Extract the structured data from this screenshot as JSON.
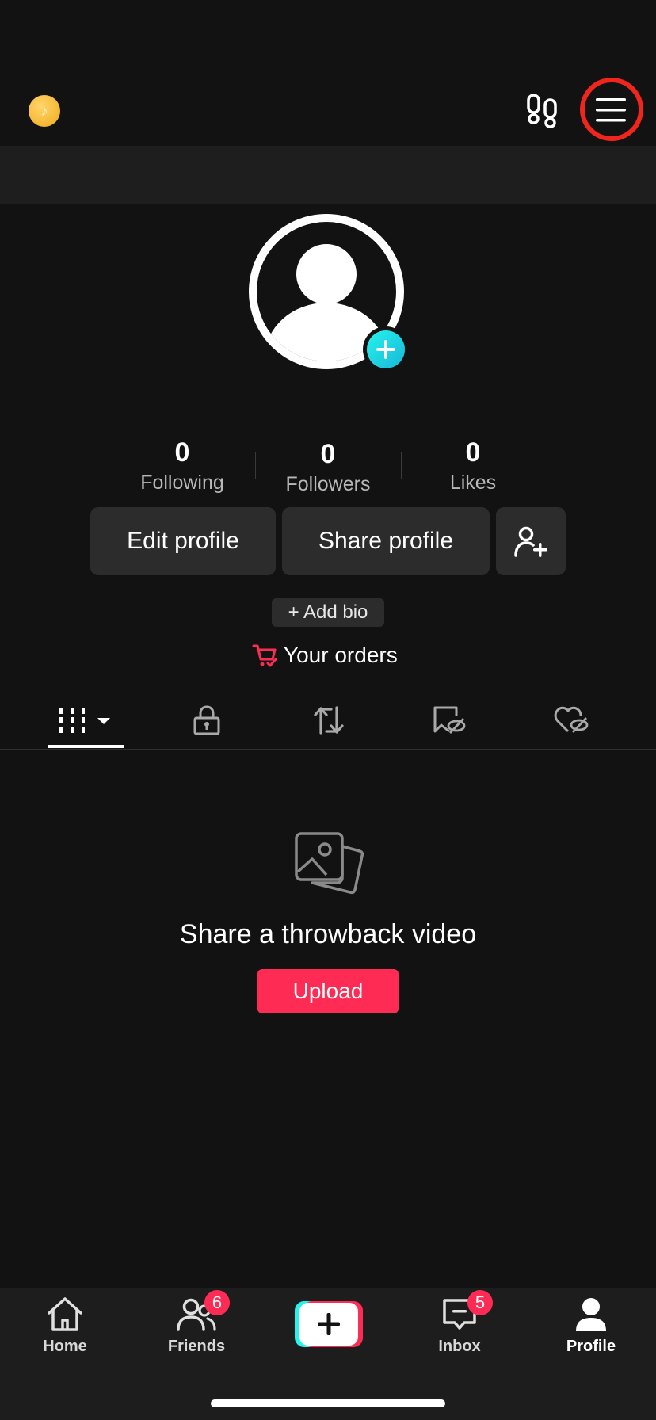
{
  "stats": {
    "following": {
      "count": "0",
      "label": "Following"
    },
    "followers": {
      "count": "0",
      "label": "Followers"
    },
    "likes": {
      "count": "0",
      "label": "Likes"
    }
  },
  "actions": {
    "edit_profile": "Edit profile",
    "share_profile": "Share profile",
    "add_bio": "+ Add bio",
    "your_orders": "Your orders"
  },
  "tabs": [
    {
      "icon": "grid-icon",
      "selected": true
    },
    {
      "icon": "lock-icon",
      "selected": false
    },
    {
      "icon": "repost-icon",
      "selected": false
    },
    {
      "icon": "hidden-bookmark-icon",
      "selected": false
    },
    {
      "icon": "hidden-heart-icon",
      "selected": false
    }
  ],
  "empty_state": {
    "title": "Share a throwback video",
    "button": "Upload"
  },
  "nav": {
    "home": "Home",
    "friends": "Friends",
    "friends_badge": "6",
    "inbox": "Inbox",
    "inbox_badge": "5",
    "profile": "Profile"
  },
  "colors": {
    "background": "#121212",
    "accent": "#fe2c55",
    "teal": "#25f4ee",
    "highlight_circle": "#f0261c"
  }
}
